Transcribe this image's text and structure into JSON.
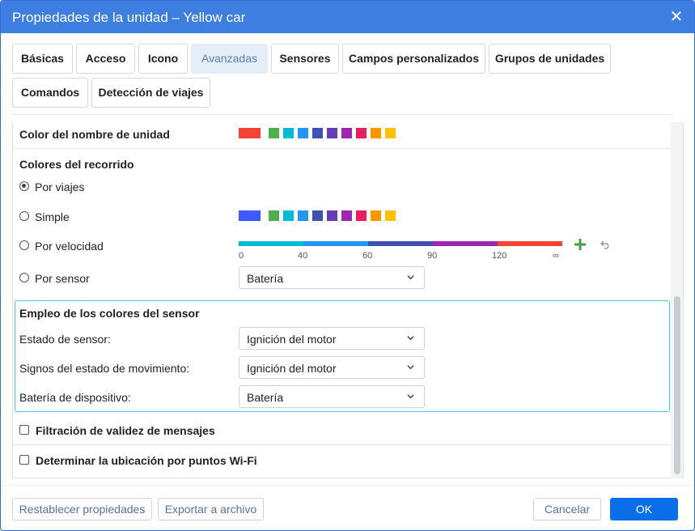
{
  "window": {
    "title": "Propiedades de la unidad – Yellow car",
    "close_glyph": "✕"
  },
  "tabs": [
    {
      "label": "Básicas"
    },
    {
      "label": "Acceso"
    },
    {
      "label": "Icono"
    },
    {
      "label": "Avanzadas",
      "active": true
    },
    {
      "label": "Sensores"
    },
    {
      "label": "Campos personalizados"
    },
    {
      "label": "Grupos de unidades"
    },
    {
      "label": "Comandos"
    },
    {
      "label": "Detección de viajes"
    }
  ],
  "unit_name_color": {
    "label": "Color del nombre de unidad",
    "selected": "#f44336",
    "palette": [
      "#4caf50",
      "#00bcd4",
      "#2196f3",
      "#3f51b5",
      "#673ab7",
      "#9c27b0",
      "#e91e63",
      "#ff9800",
      "#ffc107"
    ]
  },
  "track_colors": {
    "heading": "Colores del recorrido",
    "by_trips": "Por viajes",
    "simple": "Simple",
    "simple_selected": "#3d5afe",
    "simple_palette": [
      "#4caf50",
      "#00bcd4",
      "#2196f3",
      "#3f51b5",
      "#673ab7",
      "#9c27b0",
      "#e91e63",
      "#ff9800",
      "#ffc107"
    ],
    "by_speed": "Por velocidad",
    "speed_segments": [
      "#00bcd4",
      "#2196f3",
      "#3f51b5",
      "#9c27b0",
      "#f44336"
    ],
    "speed_ticks": [
      "0",
      "40",
      "60",
      "90",
      "120",
      "∞"
    ],
    "by_sensor": "Por sensor",
    "sensor_value": "Batería",
    "selected": "by_trips"
  },
  "sensor_colors": {
    "heading": "Empleo de los colores del sensor",
    "state_label": "Estado de sensor:",
    "state_value": "Ignición del motor",
    "motion_label": "Signos del estado de movimiento:",
    "motion_value": "Ignición del motor",
    "battery_label": "Batería de dispositivo:",
    "battery_value": "Batería"
  },
  "options": {
    "filter_label": "Filtración de validez de mensajes",
    "wifi_label": "Determinar la ubicación por puntos Wi-Fi"
  },
  "footer": {
    "reset": "Restablecer propiedades",
    "export": "Exportar a archivo",
    "cancel": "Cancelar",
    "ok": "OK"
  },
  "colors": {
    "accent": "#3d7fe0",
    "primary_button": "#0a6ee8",
    "highlight_border": "#4fc9d6",
    "add_icon": "#43a047"
  }
}
